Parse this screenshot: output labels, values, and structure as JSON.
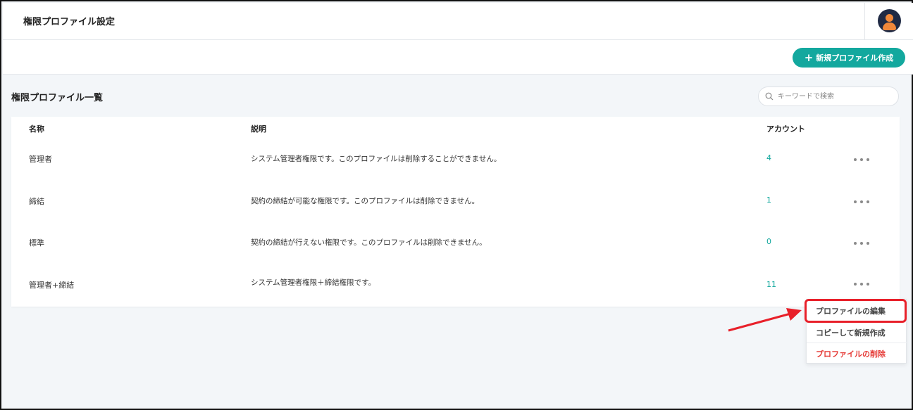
{
  "header": {
    "title": "権限プロファイル設定",
    "avatar_icon": "user-avatar-icon"
  },
  "actions": {
    "new_profile_label": "新規プロファイル作成",
    "new_profile_icon": "plus-icon",
    "accent_color": "#13a89e"
  },
  "list": {
    "title": "権限プロファイル一覧",
    "search_placeholder": "キーワードで検索",
    "columns": {
      "name": "名称",
      "description": "説明",
      "accounts": "アカウント"
    },
    "rows": [
      {
        "name": "管理者",
        "description": "システム管理者権限です。このプロファイルは削除することができません。",
        "accounts": "4"
      },
      {
        "name": "締結",
        "description": "契約の締結が可能な権限です。このプロファイルは削除できません。",
        "accounts": "1"
      },
      {
        "name": "標準",
        "description": "契約の締結が行えない権限です。このプロファイルは削除できません。",
        "accounts": "0"
      },
      {
        "name": "管理者+締結",
        "description": "システム管理者権限＋締結権限です。",
        "accounts": "11"
      }
    ]
  },
  "context_menu": {
    "items": [
      {
        "label": "プロファイルの編集"
      },
      {
        "label": "コピーして新規作成"
      },
      {
        "label": "プロファイルの削除"
      }
    ],
    "danger_color": "#e53935"
  },
  "annotation": {
    "highlight_color": "#e8202a"
  }
}
